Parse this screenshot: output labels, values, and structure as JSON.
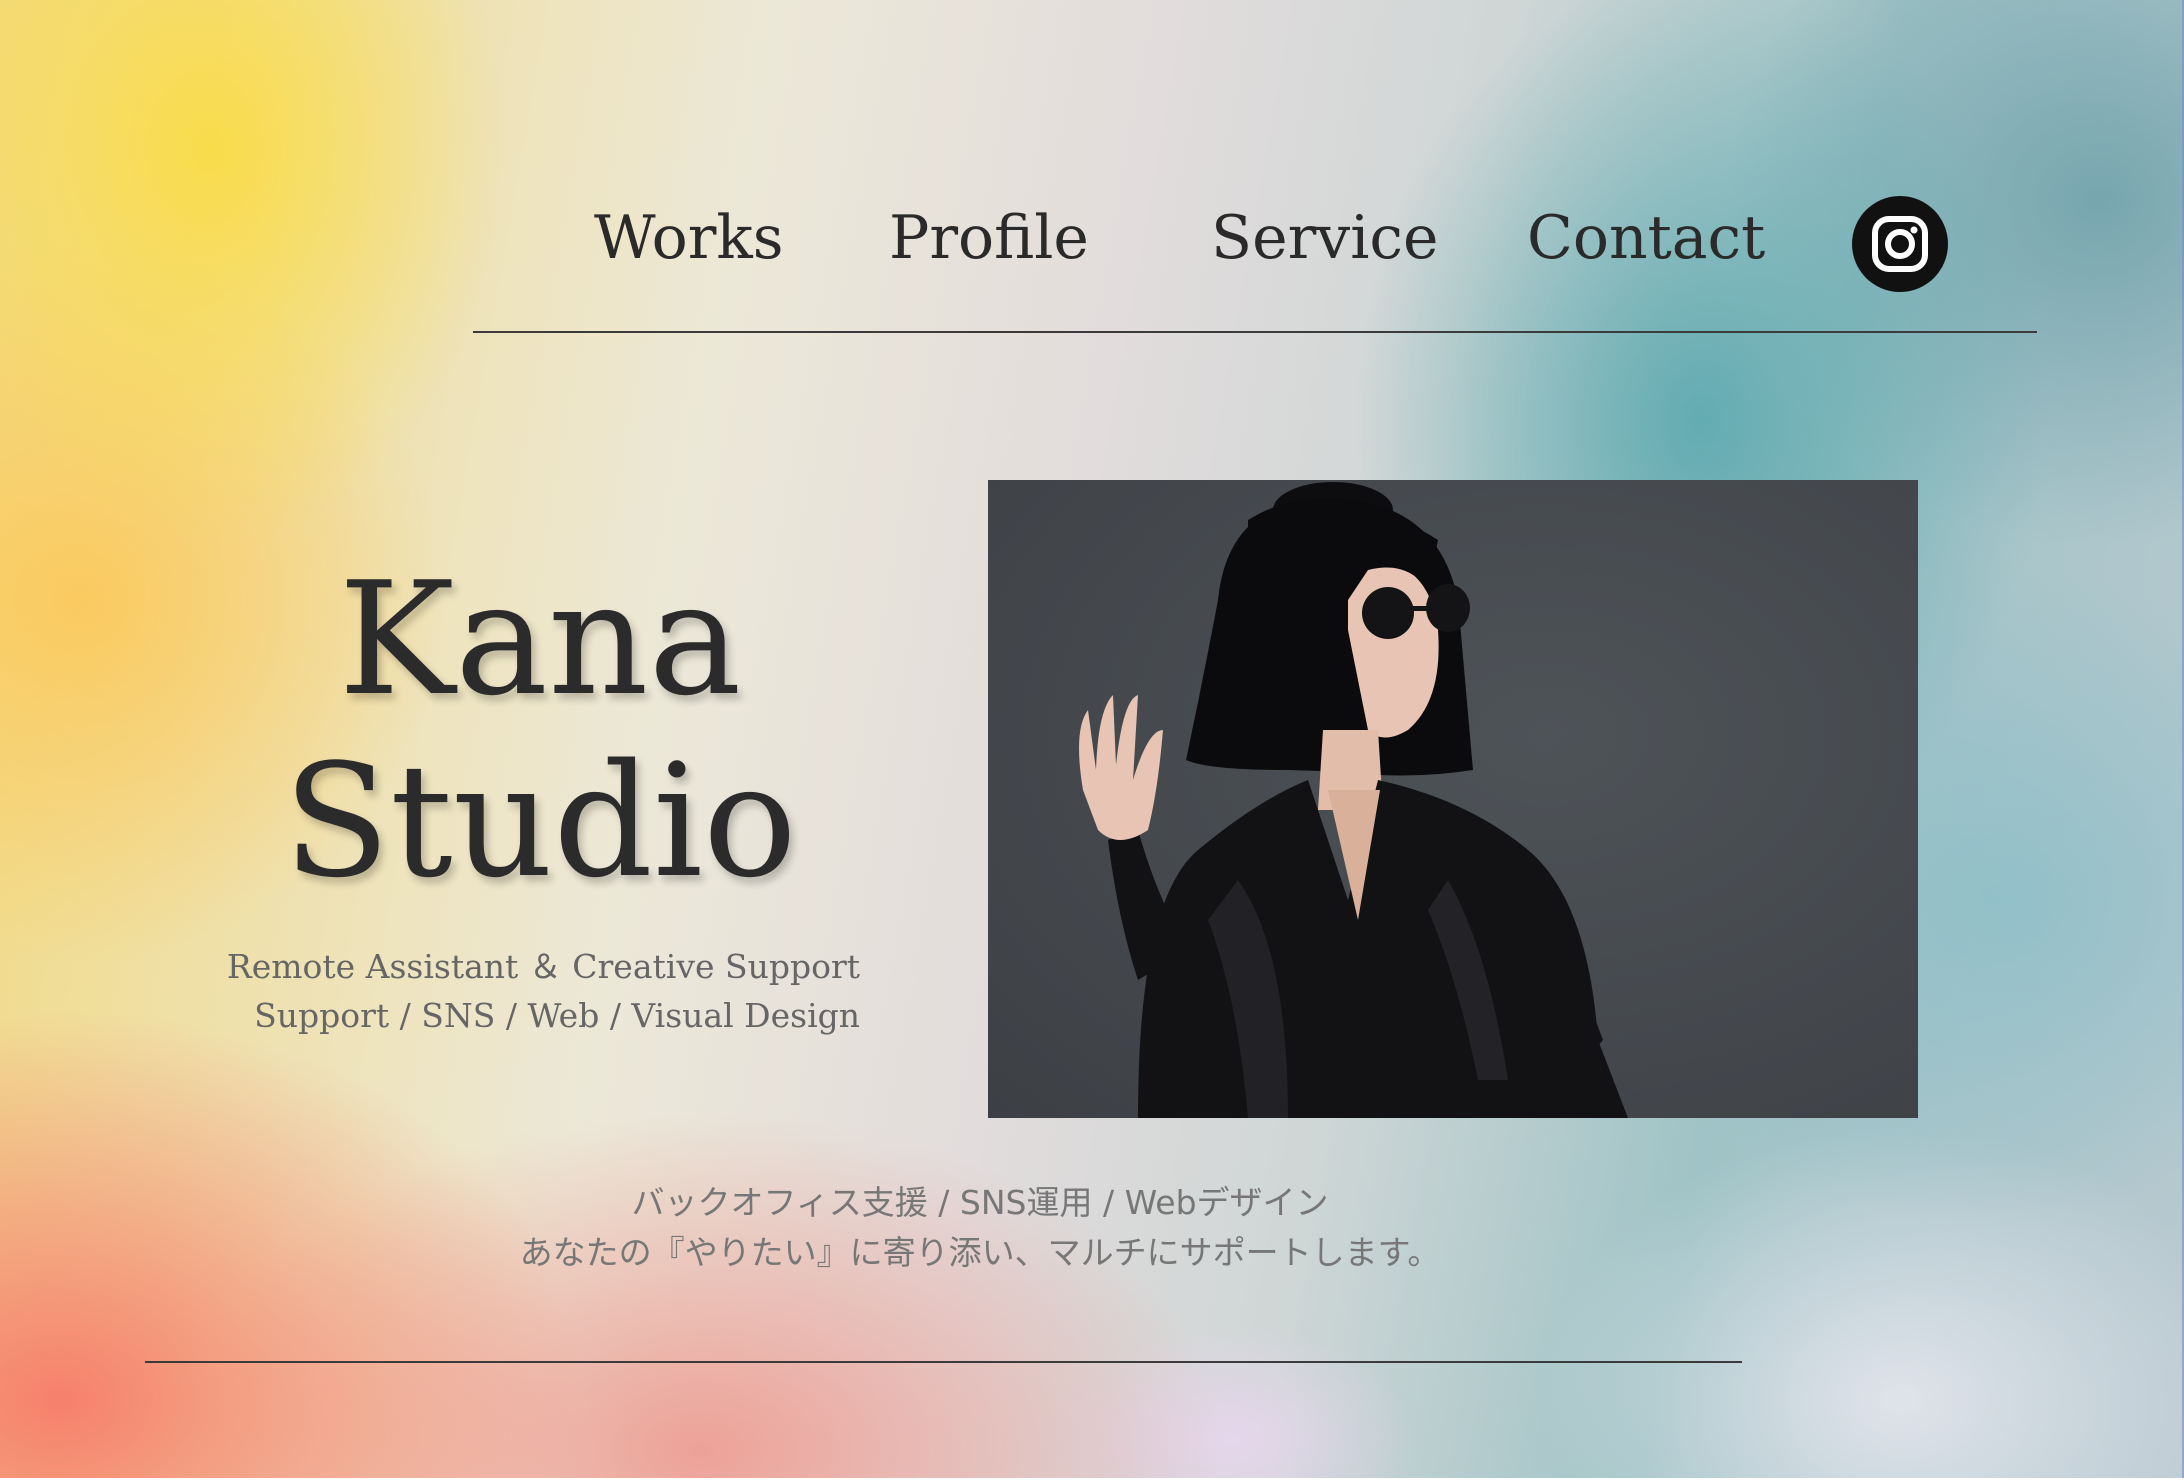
{
  "nav": {
    "items": [
      {
        "label": "Works"
      },
      {
        "label": "Profile"
      },
      {
        "label": "Service"
      },
      {
        "label": "Contact"
      }
    ],
    "social_icon": "instagram-icon"
  },
  "hero": {
    "title_line1": "Kana",
    "title_line2": "Studio",
    "tagline_line1": "Remote Assistant ＆ Creative Support",
    "tagline_line2": "Support /  SNS  /  Web  /  Visual Design"
  },
  "photo": {
    "subject": "portrait-photo"
  },
  "description": {
    "line1": "バックオフィス支援 / SNS運用 / Webデザイン",
    "line2": "あなたの『やりたい』に寄り添い、マルチにサポートします。"
  },
  "colors": {
    "text_dark": "#2a2a2a",
    "text_muted": "#666666",
    "icon_bg": "#111111"
  }
}
